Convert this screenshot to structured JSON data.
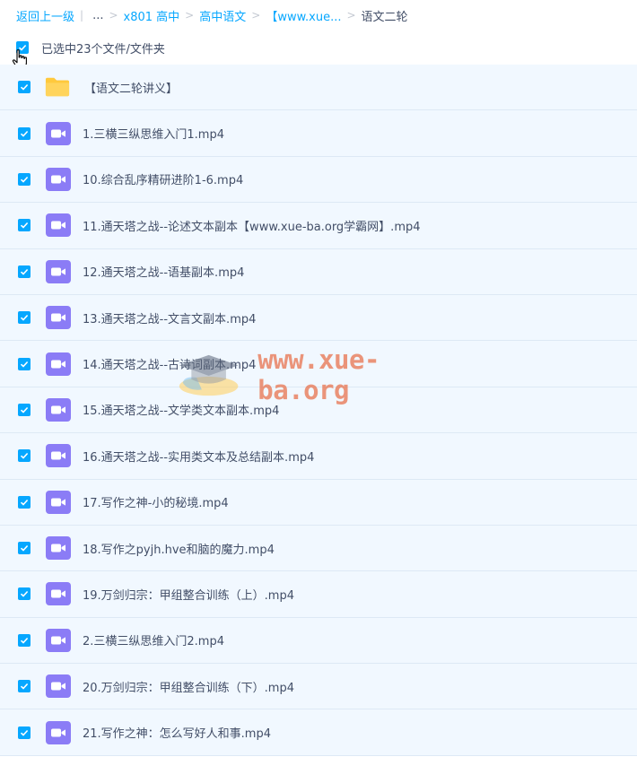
{
  "breadcrumb": {
    "back": "返回上一级",
    "ellipsis": "...",
    "items": [
      "x801 高中",
      "高中语文",
      "【www.xue..."
    ],
    "current": "语文二轮"
  },
  "selection": {
    "text": "已选中23个文件/文件夹"
  },
  "files": [
    {
      "name": "【语文二轮讲义】",
      "type": "folder"
    },
    {
      "name": "1.三横三纵思维入门1.mp4",
      "type": "video"
    },
    {
      "name": "10.综合乱序精研进阶1-6.mp4",
      "type": "video"
    },
    {
      "name": "11.通天塔之战--论述文本副本【www.xue-ba.org学霸网】.mp4",
      "type": "video"
    },
    {
      "name": "12.通天塔之战--语基副本.mp4",
      "type": "video"
    },
    {
      "name": "13.通天塔之战--文言文副本.mp4",
      "type": "video"
    },
    {
      "name": "14.通天塔之战--古诗词副本.mp4",
      "type": "video"
    },
    {
      "name": "15.通天塔之战--文学类文本副本.mp4",
      "type": "video"
    },
    {
      "name": "16.通天塔之战--实用类文本及总结副本.mp4",
      "type": "video"
    },
    {
      "name": "17.写作之神-小的秘境.mp4",
      "type": "video"
    },
    {
      "name": "18.写作之pyjh.hve和脑的魔力.mp4",
      "type": "video"
    },
    {
      "name": "19.万剑归宗：甲组整合训练（上）.mp4",
      "type": "video"
    },
    {
      "name": "2.三横三纵思维入门2.mp4",
      "type": "video"
    },
    {
      "name": "20.万剑归宗：甲组整合训练（下）.mp4",
      "type": "video"
    },
    {
      "name": "21.写作之神：怎么写好人和事.mp4",
      "type": "video"
    }
  ],
  "watermark": "www.xue-ba.org",
  "colors": {
    "accent": "#06a7ff",
    "row_bg": "#f1f8ff",
    "video_icon": "#8b7cf6",
    "folder_icon": "#ffc93c"
  }
}
